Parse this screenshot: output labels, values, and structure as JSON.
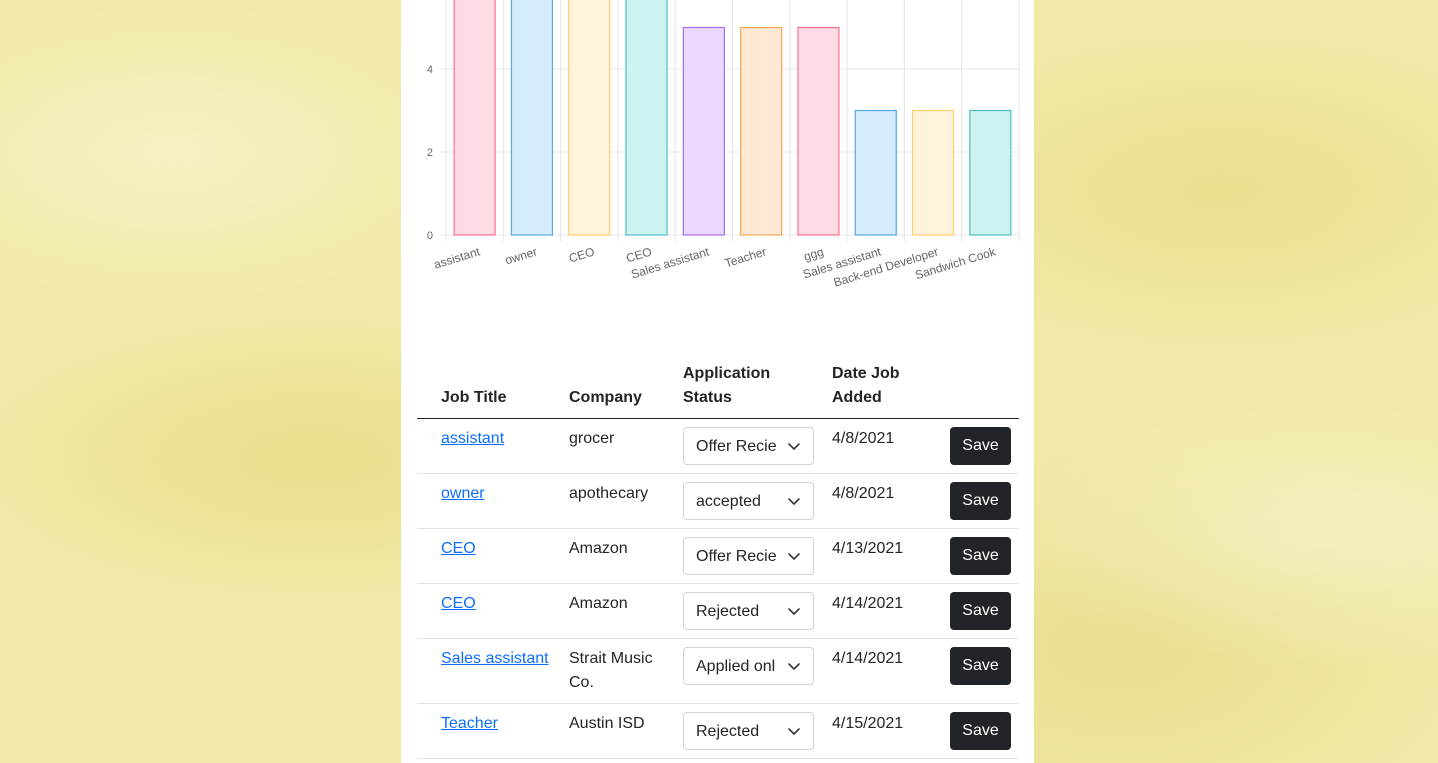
{
  "chart_data": {
    "type": "bar",
    "categories": [
      "assistant",
      "owner",
      "CEO",
      "CEO",
      "Sales assistant",
      "Teacher",
      "ggg",
      "Sales assistant",
      "Back-end Developer",
      "Sandwich Cook"
    ],
    "values": [
      6,
      6,
      6,
      6,
      5,
      5,
      5,
      3,
      3,
      3
    ],
    "yticks": [
      0,
      2,
      4
    ],
    "ylim": [
      0,
      6
    ],
    "grid": true,
    "colors": [
      {
        "fill": "#ffdbe4",
        "stroke": "#ff6f91"
      },
      {
        "fill": "#d3ebfb",
        "stroke": "#56a9e4"
      },
      {
        "fill": "#fff3dc",
        "stroke": "#ffcd67"
      },
      {
        "fill": "#cdf3f1",
        "stroke": "#4bc0c0"
      },
      {
        "fill": "#ead8ff",
        "stroke": "#a56df0"
      },
      {
        "fill": "#ffe8d4",
        "stroke": "#ffa54f"
      },
      {
        "fill": "#ffdbe4",
        "stroke": "#ff6f91"
      },
      {
        "fill": "#d3ebfb",
        "stroke": "#56a9e4"
      },
      {
        "fill": "#fff3dc",
        "stroke": "#ffcd67"
      },
      {
        "fill": "#cdf3f1",
        "stroke": "#4bc0c0"
      }
    ]
  },
  "table": {
    "headers": {
      "job_title": "Job Title",
      "company": "Company",
      "status_line1": "Application",
      "status_line2": "Status",
      "date_line1": "Date Job",
      "date_line2": "Added"
    },
    "rows": [
      {
        "title": "assistant",
        "company": "grocer",
        "status": "Offer Recie",
        "date": "4/8/2021",
        "action": "Save"
      },
      {
        "title": "owner",
        "company": "apothecary",
        "status": "accepted",
        "date": "4/8/2021",
        "action": "Save"
      },
      {
        "title": "CEO",
        "company": "Amazon",
        "status": "Offer Recie",
        "date": "4/13/2021",
        "action": "Save"
      },
      {
        "title": "CEO",
        "company": "Amazon",
        "status": "Rejected",
        "date": "4/14/2021",
        "action": "Save"
      },
      {
        "title": "Sales assistant",
        "company": "Strait Music Co.",
        "status": "Applied onl",
        "date": "4/14/2021",
        "action": "Save"
      },
      {
        "title": "Teacher",
        "company": "Austin ISD",
        "status": "Rejected",
        "date": "4/15/2021",
        "action": "Save"
      }
    ]
  },
  "colors": {
    "link": "#0d6efd",
    "button_bg": "#212529",
    "page_background": "#f1e9a6"
  }
}
